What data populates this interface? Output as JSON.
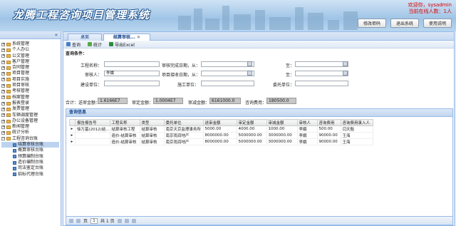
{
  "header": {
    "title": "龙腾工程咨询项目管理系统",
    "welcome": "欢迎你，sysadmin",
    "online": "当前在线人数：1人",
    "buttons": [
      "修改密码",
      "退出系统",
      "使用说明"
    ]
  },
  "sidebar": {
    "collapse": "«",
    "items": [
      "系统管理",
      "个人办公",
      "公文管理",
      "客户管理",
      "合同管理",
      "项目管理",
      "项目实施",
      "项目审核",
      "考核管理",
      "档案管理",
      "报表登录",
      "发票管理",
      "车辆调度管理",
      "办公设备管理",
      "新闻管理",
      "统计分析",
      "工程咨询台账"
    ],
    "subitems": [
      "结算审核台账",
      "概算审核台账",
      "预算编制台账",
      "造价编制台账",
      "司法鉴定台账",
      "招标代理台账"
    ]
  },
  "tabs": [
    "桌面",
    "结算审核..."
  ],
  "toolbar": {
    "query": "查询",
    "stats": "统计",
    "export": "导出Excel"
  },
  "search": {
    "section": "查询条件：",
    "project_name": "工程名称：",
    "finish_date": "审核完成日期，从：",
    "to": "至：",
    "auditor": "审核人：",
    "auditor_value": "李娥",
    "receive_date": "项目接收日期，从：",
    "to2": "至：",
    "build_unit": "建设单位：",
    "construct_unit": "施工单位：",
    "client_unit": "委托单位："
  },
  "totals": {
    "label1": "合计：送审金额：",
    "v1": "1.6166E7",
    "label2": "审定金额：",
    "v2": "1.0004E7",
    "label3": "审减金额：",
    "v3": "6161000.0",
    "label4": "咨询费用：",
    "v4": "180500.0"
  },
  "grid": {
    "title": "查询信息",
    "columns": [
      "报告报告号",
      "工程名称",
      "类型",
      "委托单位",
      "送审金额",
      "审定金额",
      "审减金额",
      "审核人",
      "咨询费用",
      "咨询费用录入人"
    ],
    "rows": [
      [
        "徐万基(2012)结...",
        "结算审核工程",
        "结算审核",
        "南京天京监理事务所",
        "5000.00",
        "4000.00",
        "1000.00",
        "李娥",
        "500.00",
        "闫天魁"
      ],
      [
        "",
        "造价-结算审核",
        "结算审核",
        "南京雨润地产",
        "8000000.00",
        "5000000.00",
        "3000000.00",
        "李娥",
        "90000.00",
        "王海"
      ],
      [
        "",
        "造价-结算审核",
        "结算审核",
        "南京雨润地产",
        "8000000.00",
        "5000000.00",
        "3000000.00",
        "李娥",
        "90000.00",
        "王海"
      ]
    ]
  },
  "pager": {
    "page_label": "页",
    "current": "1",
    "of": "共 1 页"
  }
}
